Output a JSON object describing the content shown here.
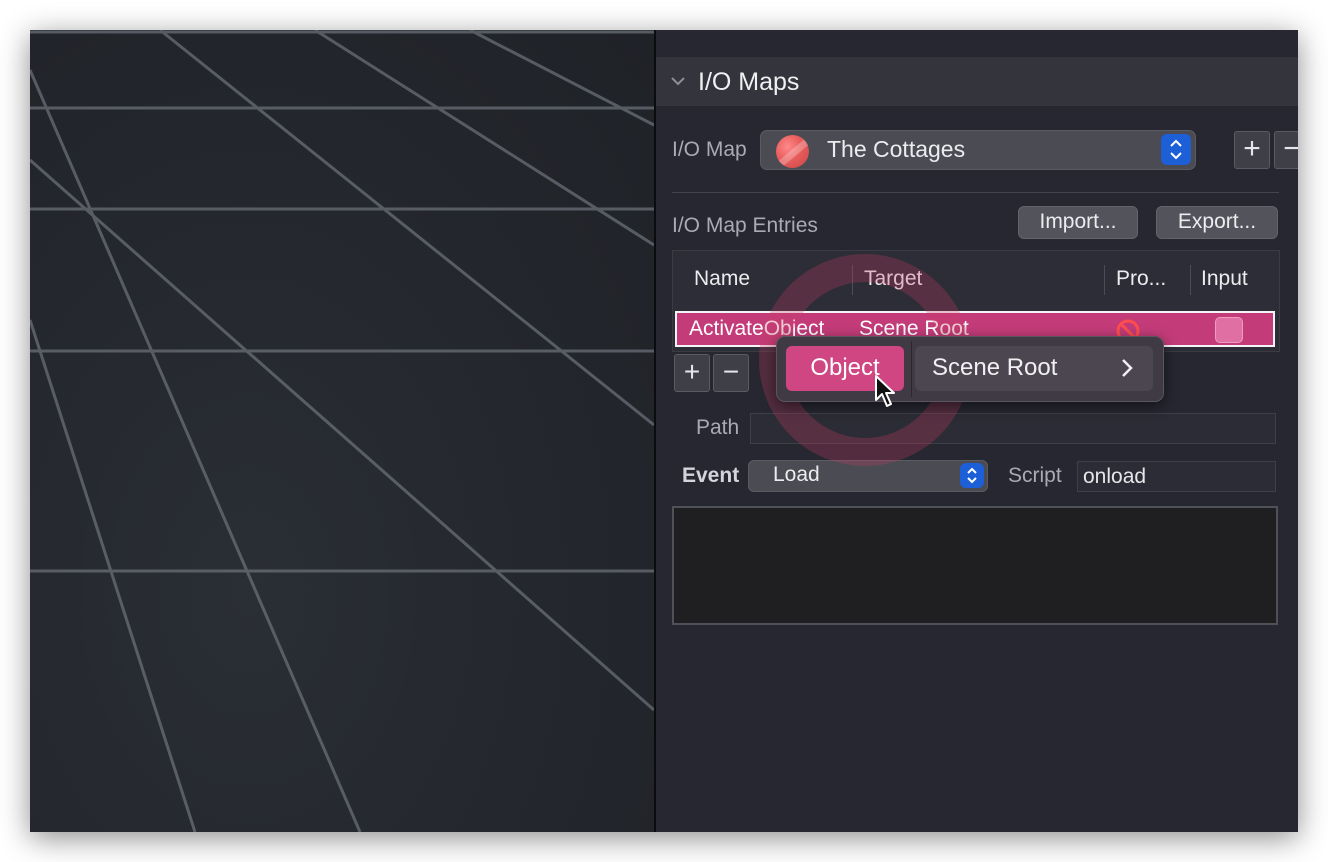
{
  "section": {
    "title": "I/O Maps"
  },
  "io_map": {
    "label": "I/O Map",
    "selected": "The Cottages",
    "add": "+",
    "remove": "−"
  },
  "entries": {
    "label": "I/O Map Entries",
    "import_label": "Import...",
    "export_label": "Export...",
    "columns": [
      "Name",
      "Target",
      "Pro...",
      "Input"
    ],
    "rows": [
      {
        "name": "ActivateObject",
        "target": "Scene Root",
        "pro_icon": "prohibited-icon",
        "input": "checkbox"
      }
    ],
    "add": "+",
    "remove": "−"
  },
  "target_menu": {
    "item_object": "Object",
    "item_scene_root": "Scene Root"
  },
  "path": {
    "label": "Path",
    "value": ""
  },
  "event": {
    "label": "Event",
    "value": "Load"
  },
  "script": {
    "label": "Script",
    "value": "onload"
  },
  "colors": {
    "selection": "#c33c79",
    "accent_blue": "#1d5fd6",
    "panel_bg": "#262731"
  }
}
